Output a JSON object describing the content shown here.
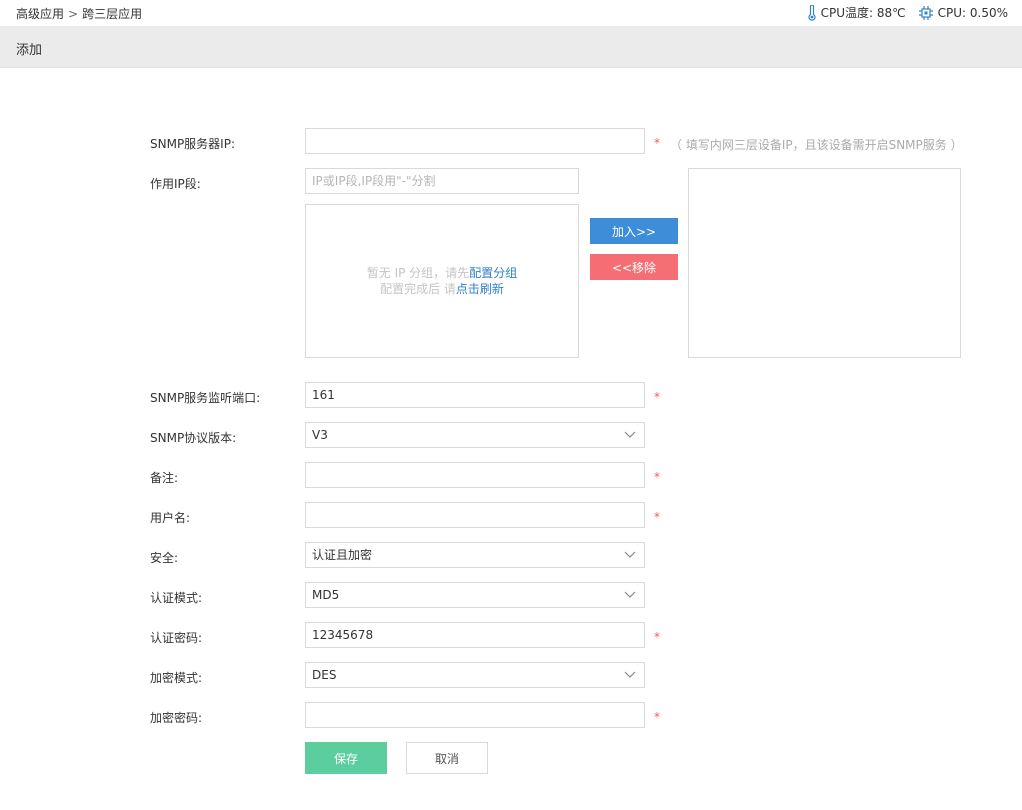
{
  "breadcrumb": {
    "parent": "高级应用",
    "separator": ">",
    "current": "跨三层应用"
  },
  "sysinfo": {
    "cpu_temp_label": "CPU温度: 88℃",
    "cpu_usage_label": "CPU: 0.50%"
  },
  "page_title": "添加",
  "form": {
    "snmp_ip": {
      "label": "SNMP服务器IP:",
      "value": "",
      "hint": "（ 填写内网三层设备IP，且该设备需开启SNMP服务 ）"
    },
    "ip_range": {
      "label": "作用IP段:",
      "placeholder": "IP或IP段,IP段用\"-\"分割",
      "empty_line1_prefix": "暂无 IP 分组，请先",
      "empty_line1_link": "配置分组",
      "empty_line2_prefix": "配置完成后 请",
      "empty_line2_link": "点击刷新"
    },
    "add_label": "加入>>",
    "remove_label": "<<移除",
    "port": {
      "label": "SNMP服务监听端口:",
      "value": "161"
    },
    "version": {
      "label": "SNMP协议版本:",
      "value": "V3"
    },
    "remark": {
      "label": "备注:",
      "value": ""
    },
    "username": {
      "label": "用户名:",
      "value": ""
    },
    "security": {
      "label": "安全:",
      "value": "认证且加密"
    },
    "auth_mode": {
      "label": "认证模式:",
      "value": "MD5"
    },
    "auth_password": {
      "label": "认证密码:",
      "value": "12345678"
    },
    "encrypt_mode": {
      "label": "加密模式:",
      "value": "DES"
    },
    "encrypt_password": {
      "label": "加密密码:",
      "value": ""
    },
    "required_mark": "*",
    "save_label": "保存",
    "cancel_label": "取消"
  },
  "colors": {
    "primary": "#3e8dd8",
    "danger": "#f46e74",
    "success": "#5ccd9c",
    "required": "#f06060"
  }
}
